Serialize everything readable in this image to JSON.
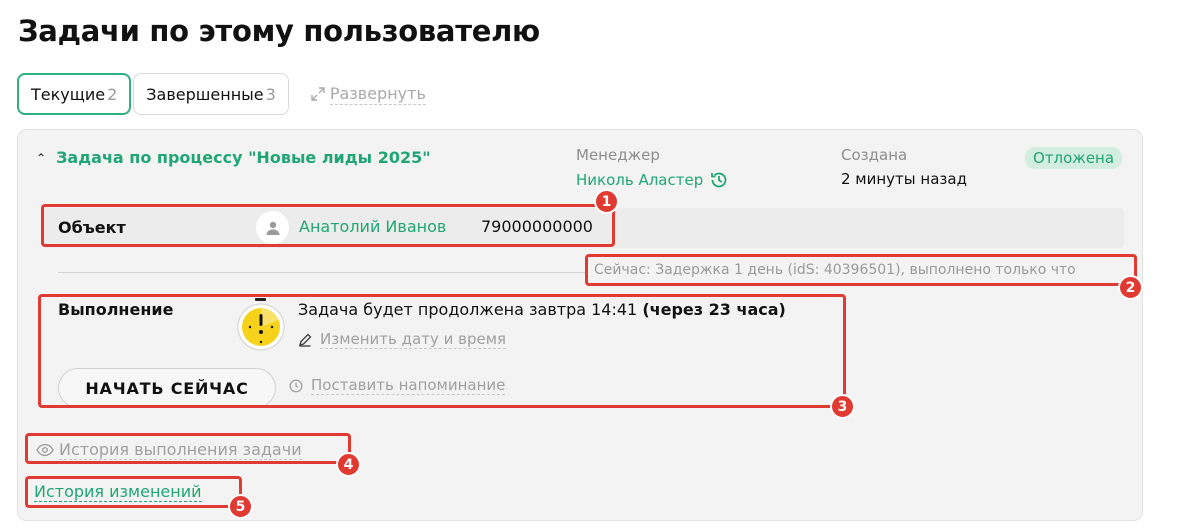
{
  "page": {
    "title": "Задачи по этому пользователю"
  },
  "tabs": [
    {
      "label": "Текущие",
      "count": "2",
      "active": true
    },
    {
      "label": "Завершенные",
      "count": "3",
      "active": false
    }
  ],
  "expand": {
    "label": "Развернуть",
    "icon": "expand-icon"
  },
  "task": {
    "title": "Задача по процессу \"Новые лиды 2025\"",
    "manager_label": "Менеджер",
    "manager_name": "Николь Аластер",
    "created_label": "Создана",
    "created_value": "2 минуты назад",
    "status": "Отложена",
    "object": {
      "label": "Объект",
      "name": "Анатолий Иванов",
      "phone": "79000000000"
    },
    "now_status": "Сейчас: Задержка 1 день (idS: 40396501), выполнено только что",
    "execution": {
      "label": "Выполнение",
      "text": "Задача будет продолжена завтра 14:41",
      "text_bold": "(через 23 часа)",
      "change_date": "Изменить дату и время",
      "start_button": "НАЧАТЬ СЕЙЧАС",
      "reminder": "Поставить напоминание"
    },
    "history_exec": "История выполнения задачи",
    "history_changes": "История изменений"
  },
  "markers": [
    "1",
    "2",
    "3",
    "4",
    "5"
  ],
  "colors": {
    "accent": "#20a674",
    "marker": "#e03a32",
    "badge_bg": "#d3ede2"
  }
}
